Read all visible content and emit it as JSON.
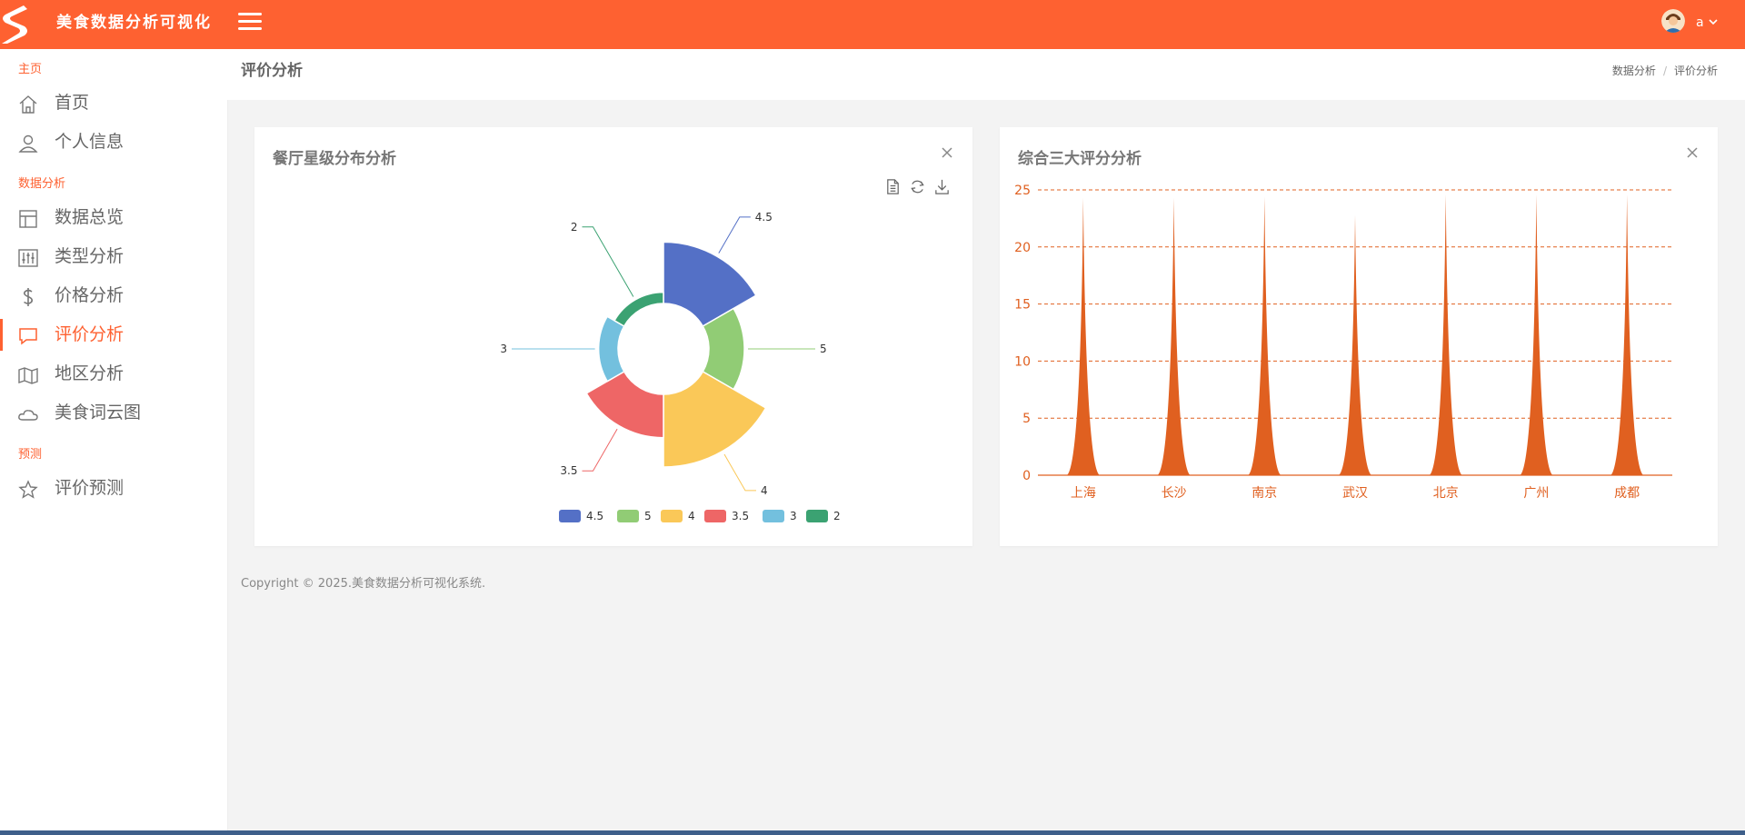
{
  "app": {
    "title": "美食数据分析可视化",
    "user_name": "a",
    "accent": "#fe6131"
  },
  "sidebar": {
    "groups": [
      {
        "label": "主页",
        "items": [
          {
            "label": "首页",
            "icon": "home-icon"
          },
          {
            "label": "个人信息",
            "icon": "user-icon"
          }
        ]
      },
      {
        "label": "数据分析",
        "items": [
          {
            "label": "数据总览",
            "icon": "layout-icon"
          },
          {
            "label": "类型分析",
            "icon": "sliders-icon"
          },
          {
            "label": "价格分析",
            "icon": "dollar-icon"
          },
          {
            "label": "评价分析",
            "icon": "comment-icon",
            "active": true
          },
          {
            "label": "地区分析",
            "icon": "map-icon"
          },
          {
            "label": "美食词云图",
            "icon": "cloud-icon"
          }
        ]
      },
      {
        "label": "预测",
        "items": [
          {
            "label": "评价预测",
            "icon": "star-icon"
          }
        ]
      }
    ]
  },
  "page": {
    "title": "评价分析",
    "breadcrumb": [
      "数据分析",
      "评价分析"
    ]
  },
  "cards": {
    "star_distribution": {
      "title": "餐厅星级分布分析"
    },
    "rating_analysis": {
      "title": "综合三大评分分析"
    }
  },
  "footer": {
    "text": "Copyright © 2025.美食数据分析可视化系统."
  },
  "chart_data": [
    {
      "type": "pie",
      "variant": "nightingale-rose",
      "title": "餐厅星级分布分析",
      "legend_position": "bottom",
      "slices": [
        {
          "name": "4.5",
          "value": 30,
          "color": "#5470c6"
        },
        {
          "name": "5",
          "value": 10,
          "color": "#91cc75"
        },
        {
          "name": "4",
          "value": 42,
          "color": "#fac858"
        },
        {
          "name": "3.5",
          "value": 15,
          "color": "#ee6666"
        },
        {
          "name": "3",
          "value": 3,
          "color": "#73c0de"
        },
        {
          "name": "2",
          "value": 1,
          "color": "#3ba272"
        }
      ]
    },
    {
      "type": "area",
      "variant": "pictorial-peak",
      "title": "综合三大评分分析",
      "color": "#e06020",
      "grid": true,
      "ylim": [
        0,
        25
      ],
      "yticks": [
        "0",
        "5",
        "10",
        "15",
        "20",
        "25"
      ],
      "categories": [
        "上海",
        "长沙",
        "南京",
        "武汉",
        "北京",
        "广州",
        "成都"
      ],
      "values": [
        24.3,
        24.3,
        24.4,
        22.8,
        24.6,
        24.6,
        24.6
      ]
    }
  ]
}
